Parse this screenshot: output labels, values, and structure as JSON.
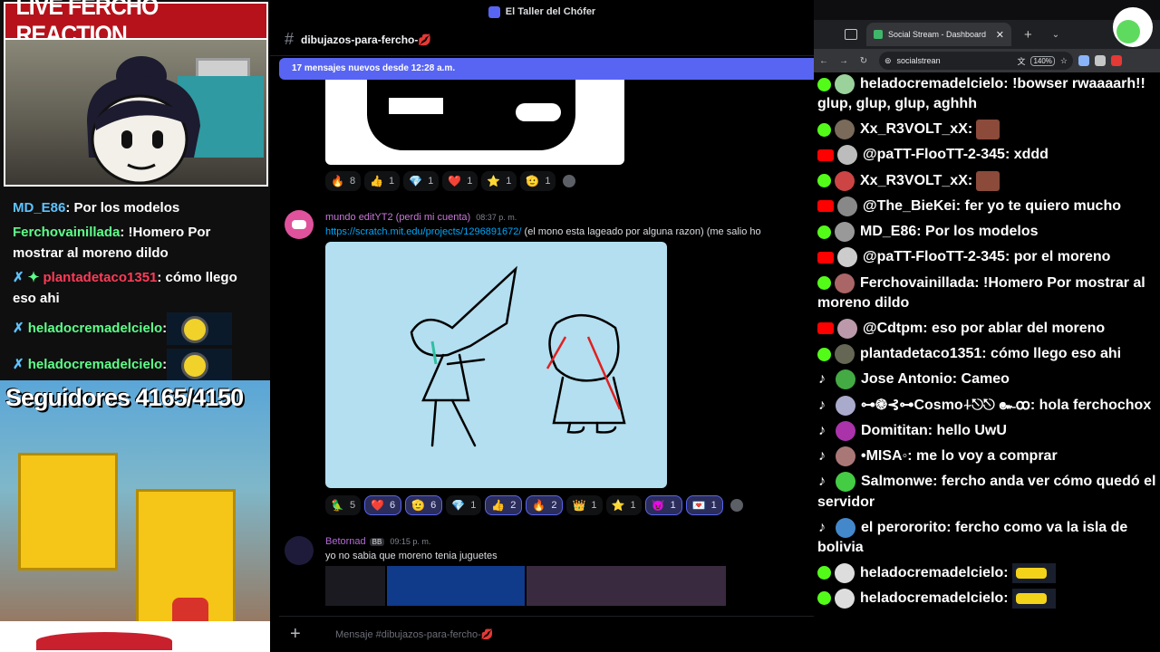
{
  "stream": {
    "banner": "LIVE FERCHO REACTION",
    "followers": "Seguidores 4165/4150",
    "chat": [
      {
        "name": "MD_E86",
        "text": ": Por los modelos",
        "color": "blue"
      },
      {
        "name": "Ferchovainillada",
        "text": ": !Homero Por mostrar al moreno dildo",
        "color": "green"
      },
      {
        "name": "plantadetaco1351",
        "text": ": cómo llego eso ahi",
        "color": "red"
      },
      {
        "name": "heladocremadelcielo",
        "text": ":",
        "color": "green"
      },
      {
        "name": "heladocremadelcielo",
        "text": ":",
        "color": "green"
      }
    ]
  },
  "discord": {
    "window_title": "El Taller del Chófer",
    "channel": "dibujazos-para-fercho-💋",
    "new_messages": "17 mensajes nuevos desde 12:28 a.m.",
    "reactions1": [
      {
        "emoji": "🔥",
        "count": "8",
        "me": false
      },
      {
        "emoji": "👍",
        "count": "1",
        "me": false
      },
      {
        "emoji": "💎",
        "count": "1",
        "me": false
      },
      {
        "emoji": "❤️",
        "count": "1",
        "me": false
      },
      {
        "emoji": "⭐",
        "count": "1",
        "me": false
      },
      {
        "emoji": "🫡",
        "count": "1",
        "me": false
      }
    ],
    "msg2": {
      "author": "mundo editYT2 (perdi mi cuenta)",
      "time": "08:37 p. m.",
      "link": "https://scratch.mit.edu/projects/1296891672/",
      "text": " (el mono esta lageado por alguna razon) (me salio ho"
    },
    "reactions2": [
      {
        "emoji": "🦜",
        "count": "5",
        "me": false
      },
      {
        "emoji": "❤️",
        "count": "6",
        "me": true
      },
      {
        "emoji": "🫡",
        "count": "6",
        "me": true
      },
      {
        "emoji": "💎",
        "count": "1",
        "me": false
      },
      {
        "emoji": "👍",
        "count": "2",
        "me": true
      },
      {
        "emoji": "🔥",
        "count": "2",
        "me": true
      },
      {
        "emoji": "👑",
        "count": "1",
        "me": false
      },
      {
        "emoji": "⭐",
        "count": "1",
        "me": false
      },
      {
        "emoji": "😈",
        "count": "1",
        "me": true
      },
      {
        "emoji": "💌",
        "count": "1",
        "me": true
      }
    ],
    "msg3": {
      "author": "Betornad",
      "tag": "BB",
      "time": "09:15 p. m.",
      "text": "yo no sabia que moreno tenia juguetes"
    },
    "composer_placeholder": "Mensaje #dibujazos-para-fercho-💋"
  },
  "browser": {
    "tab_title": "Social Stream - Dashboard",
    "url": "socialstrean",
    "zoom": "140%"
  },
  "socialstream": [
    {
      "plat": "kick",
      "name": "heladocremadelcielo",
      "text": ": !bowser rwaaaarh!! glup, glup, glup, aghhh"
    },
    {
      "plat": "kick",
      "name": "Xx_R3VOLT_xX",
      "text": ":",
      "sticker": true
    },
    {
      "plat": "yt",
      "name": "@paTT-FlooTT-2-345",
      "text": ": xddd"
    },
    {
      "plat": "kick",
      "name": "Xx_R3VOLT_xX",
      "text": ":",
      "sticker": true
    },
    {
      "plat": "yt",
      "name": "@The_BieKei",
      "text": ": fer yo te quiero mucho"
    },
    {
      "plat": "kick",
      "name": "MD_E86",
      "text": ": Por los modelos"
    },
    {
      "plat": "yt",
      "name": "@paTT-FlooTT-2-345",
      "text": ": por el moreno"
    },
    {
      "plat": "kick",
      "name": "Ferchovainillada",
      "text": ": !Homero Por mostrar al moreno dildo"
    },
    {
      "plat": "yt",
      "name": "@Cdtpm",
      "text": ": eso por ablar del moreno"
    },
    {
      "plat": "kick",
      "name": "plantadetaco1351",
      "text": ": cómo llego eso ahi"
    },
    {
      "plat": "tt",
      "name": "Jose Antonio",
      "text": ": Cameo"
    },
    {
      "plat": "tt",
      "name": "⊶֎⊰⊶Cosmo⍭⎋⎋ ๛ꝏ",
      "text": ": hola ferchochox"
    },
    {
      "plat": "tt",
      "name": "Domititan",
      "text": ": hello UwU"
    },
    {
      "plat": "tt",
      "name": "•MISA◦",
      "text": ": me lo voy a comprar"
    },
    {
      "plat": "tt",
      "name": "Salmonwe",
      "text": ": fercho anda ver cómo quedó el servidor"
    },
    {
      "plat": "tt",
      "name": "el perororito",
      "text": ": fercho como va la isla de bolivia"
    },
    {
      "plat": "kick",
      "name": "heladocremadelcielo",
      "text": ":",
      "emote": true
    },
    {
      "plat": "kick",
      "name": "heladocremadelcielo",
      "text": ":",
      "emote": true
    }
  ],
  "colors": {
    "discord_blurple": "#5865f2",
    "kick_green": "#53fc18",
    "youtube_red": "#ff0000",
    "banner_red": "#b5121b"
  }
}
